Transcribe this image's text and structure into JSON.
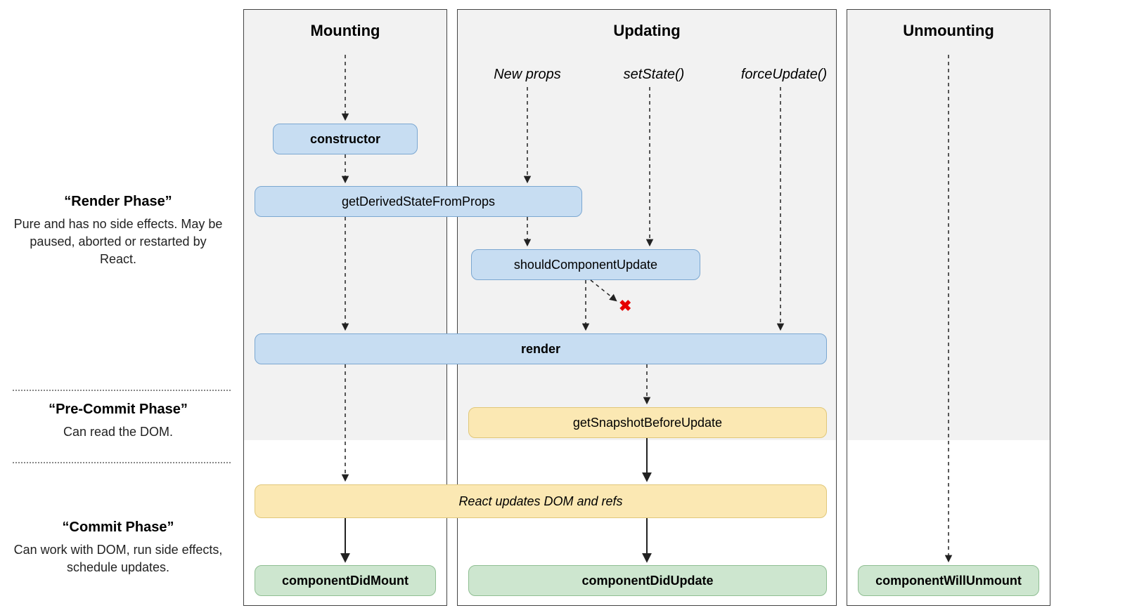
{
  "columns": {
    "mounting": "Mounting",
    "updating": "Updating",
    "unmounting": "Unmounting"
  },
  "phases": {
    "render": {
      "title": "“Render Phase”",
      "desc": "Pure and has no side effects. May be paused, aborted or restarted by React."
    },
    "precommit": {
      "title": "“Pre-Commit Phase”",
      "desc": "Can read the DOM."
    },
    "commit": {
      "title": "“Commit Phase”",
      "desc": "Can work with DOM, run side effects, schedule updates."
    }
  },
  "triggers": {
    "newProps": "New props",
    "setState": "setState()",
    "forceUpdate": "forceUpdate()"
  },
  "nodes": {
    "constructor": "constructor",
    "getDerivedStateFromProps": "getDerivedStateFromProps",
    "shouldComponentUpdate": "shouldComponentUpdate",
    "render": "render",
    "getSnapshotBeforeUpdate": "getSnapshotBeforeUpdate",
    "reactUpdates": "React updates DOM and refs",
    "componentDidMount": "componentDidMount",
    "componentDidUpdate": "componentDidUpdate",
    "componentWillUnmount": "componentWillUnmount"
  },
  "symbols": {
    "cross": "✖"
  }
}
